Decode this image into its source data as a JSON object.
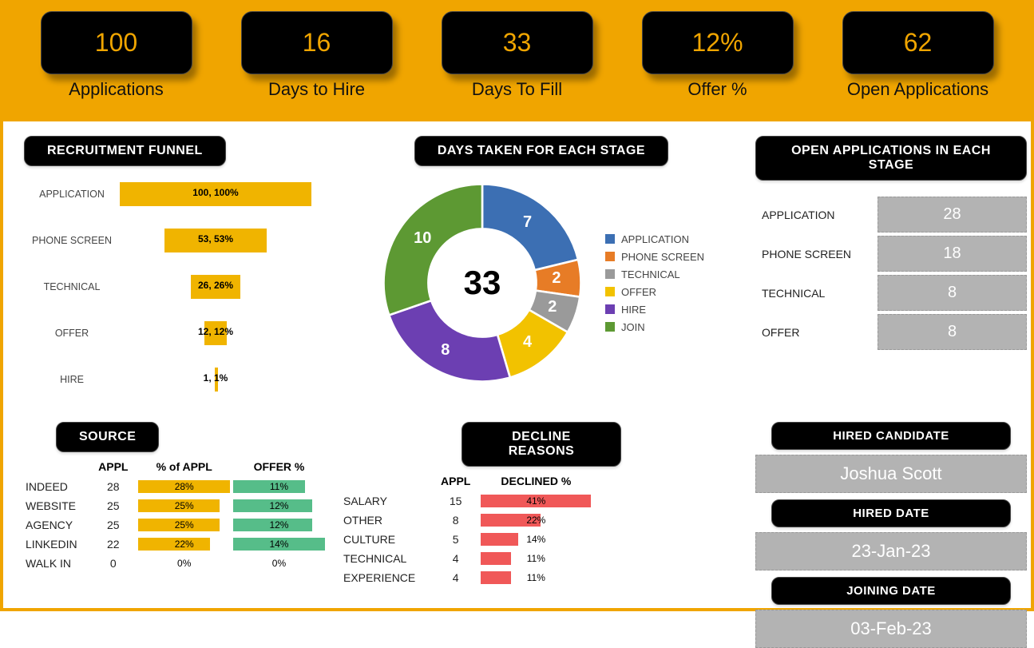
{
  "kpis": [
    {
      "value": "100",
      "label": "Applications"
    },
    {
      "value": "16",
      "label": "Days to Hire"
    },
    {
      "value": "33",
      "label": "Days To Fill"
    },
    {
      "value": "12%",
      "label": "Offer %"
    },
    {
      "value": "62",
      "label": "Open Applications"
    }
  ],
  "funnel": {
    "title": "RECRUITMENT FUNNEL",
    "rows": [
      {
        "name": "APPLICATION",
        "label": "100, 100%",
        "pct": 100
      },
      {
        "name": "PHONE SCREEN",
        "label": "53, 53%",
        "pct": 53
      },
      {
        "name": "TECHNICAL",
        "label": "26, 26%",
        "pct": 26
      },
      {
        "name": "OFFER",
        "label": "12, 12%",
        "pct": 12
      },
      {
        "name": "HIRE",
        "label": "1, 1%",
        "pct": 1
      }
    ]
  },
  "donut": {
    "title": "DAYS TAKEN FOR EACH STAGE",
    "total_label": "33",
    "legend": [
      {
        "name": "APPLICATION",
        "color": "#3c6fb3"
      },
      {
        "name": "PHONE SCREEN",
        "color": "#e77c26"
      },
      {
        "name": "TECHNICAL",
        "color": "#9a9a9a"
      },
      {
        "name": "OFFER",
        "color": "#f2c200"
      },
      {
        "name": "HIRE",
        "color": "#6c3fb2"
      },
      {
        "name": "JOIN",
        "color": "#5d9933"
      }
    ]
  },
  "open_stage": {
    "title": "OPEN APPLICATIONS IN EACH STAGE",
    "rows": [
      {
        "name": "APPLICATION",
        "value": "28"
      },
      {
        "name": "PHONE SCREEN",
        "value": "18"
      },
      {
        "name": "TECHNICAL",
        "value": "8"
      },
      {
        "name": "OFFER",
        "value": "8"
      }
    ]
  },
  "source": {
    "title": "SOURCE",
    "head": {
      "appl": "APPL",
      "pct": "% of APPL",
      "offer": "OFFER %"
    },
    "rows": [
      {
        "name": "INDEED",
        "appl": "28",
        "pct": "28%",
        "pw": 100,
        "offer": "11%",
        "ow": 78
      },
      {
        "name": "WEBSITE",
        "appl": "25",
        "pct": "25%",
        "pw": 89,
        "offer": "12%",
        "ow": 86
      },
      {
        "name": "AGENCY",
        "appl": "25",
        "pct": "25%",
        "pw": 89,
        "offer": "12%",
        "ow": 86
      },
      {
        "name": "LINKEDIN",
        "appl": "22",
        "pct": "22%",
        "pw": 78,
        "offer": "14%",
        "ow": 100
      },
      {
        "name": "WALK IN",
        "appl": "0",
        "pct": "0%",
        "pw": 0,
        "offer": "0%",
        "ow": 0
      }
    ]
  },
  "decline": {
    "title": "DECLINE REASONS",
    "head": {
      "appl": "APPL",
      "declined": "DECLINED %"
    },
    "rows": [
      {
        "name": "SALARY",
        "appl": "15",
        "pct": "41%",
        "pw": 100
      },
      {
        "name": "OTHER",
        "appl": "8",
        "pct": "22%",
        "pw": 54
      },
      {
        "name": "CULTURE",
        "appl": "5",
        "pct": "14%",
        "pw": 34
      },
      {
        "name": "TECHNICAL",
        "appl": "4",
        "pct": "11%",
        "pw": 27
      },
      {
        "name": "EXPERIENCE",
        "appl": "4",
        "pct": "11%",
        "pw": 27
      }
    ]
  },
  "hired": {
    "cand_label": "HIRED CANDIDATE",
    "cand_value": "Joshua Scott",
    "date_label": "HIRED DATE",
    "date_value": "23-Jan-23",
    "join_label": "JOINING DATE",
    "join_value": "03-Feb-23"
  },
  "chart_data": [
    {
      "type": "bar",
      "title": "RECRUITMENT FUNNEL",
      "orientation": "horizontal-centred",
      "categories": [
        "APPLICATION",
        "PHONE SCREEN",
        "TECHNICAL",
        "OFFER",
        "HIRE"
      ],
      "values": [
        100,
        53,
        26,
        12,
        1
      ],
      "value_labels": [
        "100, 100%",
        "53, 53%",
        "26, 26%",
        "12, 12%",
        "1, 1%"
      ],
      "xlabel": "",
      "ylabel": "",
      "xlim": [
        0,
        100
      ]
    },
    {
      "type": "pie",
      "title": "DAYS TAKEN FOR EACH STAGE",
      "center_label": "33",
      "categories": [
        "APPLICATION",
        "PHONE SCREEN",
        "TECHNICAL",
        "OFFER",
        "HIRE",
        "JOIN"
      ],
      "values": [
        7,
        2,
        2,
        4,
        8,
        10
      ],
      "colors": [
        "#3c6fb3",
        "#e77c26",
        "#9a9a9a",
        "#f2c200",
        "#6c3fb2",
        "#5d9933"
      ]
    },
    {
      "type": "table",
      "title": "OPEN APPLICATIONS IN EACH STAGE",
      "categories": [
        "APPLICATION",
        "PHONE SCREEN",
        "TECHNICAL",
        "OFFER"
      ],
      "values": [
        28,
        18,
        8,
        8
      ]
    },
    {
      "type": "bar",
      "title": "SOURCE",
      "categories": [
        "INDEED",
        "WEBSITE",
        "AGENCY",
        "LINKEDIN",
        "WALK IN"
      ],
      "series": [
        {
          "name": "APPL",
          "values": [
            28,
            25,
            25,
            22,
            0
          ]
        },
        {
          "name": "% of APPL",
          "values": [
            28,
            25,
            25,
            22,
            0
          ]
        },
        {
          "name": "OFFER %",
          "values": [
            11,
            12,
            12,
            14,
            0
          ]
        }
      ],
      "xlabel": "",
      "ylabel": ""
    },
    {
      "type": "bar",
      "title": "DECLINE REASONS",
      "categories": [
        "SALARY",
        "OTHER",
        "CULTURE",
        "TECHNICAL",
        "EXPERIENCE"
      ],
      "series": [
        {
          "name": "APPL",
          "values": [
            15,
            8,
            5,
            4,
            4
          ]
        },
        {
          "name": "DECLINED %",
          "values": [
            41,
            22,
            14,
            11,
            11
          ]
        }
      ],
      "xlabel": "",
      "ylabel": ""
    }
  ]
}
